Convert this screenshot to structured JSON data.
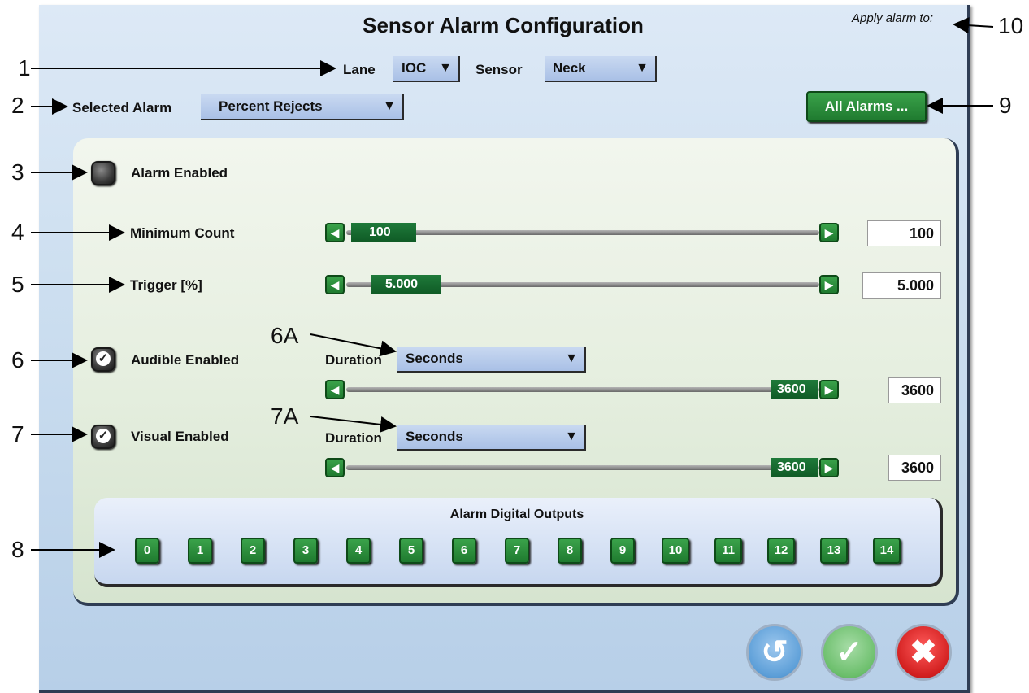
{
  "title": "Sensor Alarm Configuration",
  "apply_alarm_to": "Apply alarm to:",
  "lane": {
    "label": "Lane",
    "value": "IOC"
  },
  "sensor": {
    "label": "Sensor",
    "value": "Neck"
  },
  "selected_alarm": {
    "label": "Selected Alarm",
    "value": "Percent Rejects"
  },
  "all_alarms_label": "All Alarms ...",
  "alarm_enabled": {
    "label": "Alarm Enabled",
    "checked": false
  },
  "minimum_count": {
    "label": "Minimum Count",
    "value": "100",
    "box": "100"
  },
  "trigger": {
    "label": "Trigger [%]",
    "value": "5.000",
    "box": "5.000"
  },
  "audible": {
    "label": "Audible Enabled",
    "checked": true,
    "duration_label": "Duration",
    "duration_unit": "Seconds",
    "value": "3600",
    "box": "3600"
  },
  "visual": {
    "label": "Visual Enabled",
    "checked": true,
    "duration_label": "Duration",
    "duration_unit": "Seconds",
    "value": "3600",
    "box": "3600"
  },
  "outputs": {
    "title": "Alarm Digital Outputs",
    "buttons": [
      "0",
      "1",
      "2",
      "3",
      "4",
      "5",
      "6",
      "7",
      "8",
      "9",
      "10",
      "11",
      "12",
      "13",
      "14"
    ]
  },
  "callouts": {
    "c1": "1",
    "c2": "2",
    "c3": "3",
    "c4": "4",
    "c5": "5",
    "c6": "6",
    "c7": "7",
    "c8": "8",
    "c9": "9",
    "c10": "10",
    "c6a": "6A",
    "c7a": "7A"
  },
  "icons": {
    "dropdown": "caret-down-icon",
    "left": "arrow-left-icon",
    "right": "arrow-right-icon",
    "reset": "undo-icon",
    "ok": "check-icon",
    "cancel": "close-icon"
  },
  "colors": {
    "accent_green": "#1f7a2f",
    "cancel_red": "#d21f1f",
    "ok_green": "#5cb85c",
    "reset_blue": "#6aa6dc"
  }
}
